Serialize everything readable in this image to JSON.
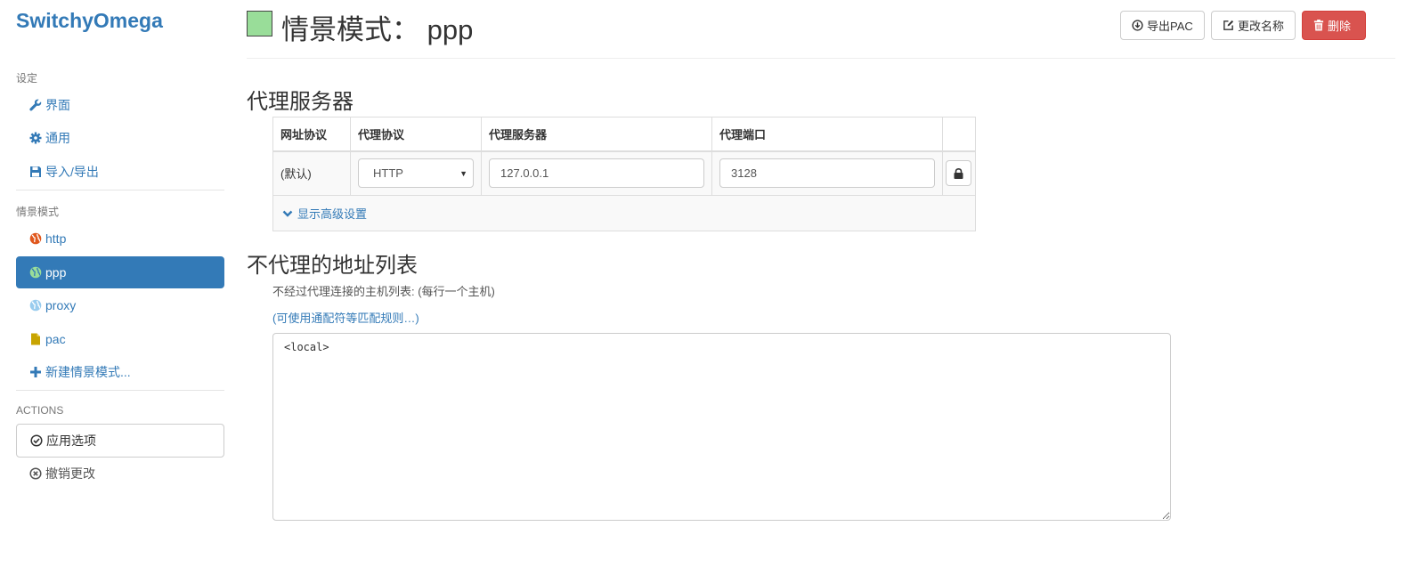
{
  "brand": "SwitchyOmega",
  "sidebar": {
    "settings_header": "设定",
    "settings_items": [
      {
        "label": "界面",
        "icon": "wrench-icon"
      },
      {
        "label": "通用",
        "icon": "gear-icon"
      },
      {
        "label": "导入/导出",
        "icon": "floppy-icon"
      }
    ],
    "profiles_header": "情景模式",
    "profiles": [
      {
        "label": "http",
        "icon": "globe-icon",
        "color": "#e0571d"
      },
      {
        "label": "ppp",
        "icon": "globe-icon",
        "color": "#99dd99",
        "active": true
      },
      {
        "label": "proxy",
        "icon": "globe-icon",
        "color": "#99ccee"
      },
      {
        "label": "pac",
        "icon": "file-icon",
        "color": "#c8a400"
      }
    ],
    "new_profile": "新建情景模式...",
    "actions_header": "ACTIONS",
    "apply": "应用选项",
    "discard": "撤销更改"
  },
  "header": {
    "title": "情景模式： ppp",
    "swatch_color": "#99dd99",
    "export_pac": "导出PAC",
    "rename": "更改名称",
    "delete": "删除"
  },
  "proxy_servers": {
    "title": "代理服务器",
    "columns": [
      "网址协议",
      "代理协议",
      "代理服务器",
      "代理端口"
    ],
    "row": {
      "scheme": "(默认)",
      "protocol": "HTTP",
      "server": "127.0.0.1",
      "port": "3128"
    },
    "advanced": "显示高级设置"
  },
  "bypass": {
    "title": "不代理的地址列表",
    "help": "不经过代理连接的主机列表: (每行一个主机)",
    "wildcard_link": "(可使用通配符等匹配规则…)",
    "value": "<local>"
  },
  "colors": {
    "primary": "#337ab7",
    "danger": "#d9534f"
  }
}
